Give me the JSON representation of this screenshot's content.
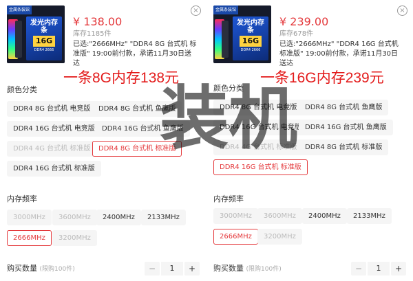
{
  "panels": [
    {
      "thumb": {
        "tag": "金属条装馆",
        "title": "发光内存条",
        "capacity": "16G",
        "subtitle": "DDR4 2666"
      },
      "price": "¥ 138.00",
      "stock": "库存1185件",
      "selected": "已选:\"2666MHz\" \"DDR4 8G 台式机 标准版\" 19:00前付款，承诺11月30日送达",
      "overlay": "一条8G内存138元",
      "color_section_title": "颜色分类",
      "colors": [
        {
          "label": "DDR4 8G 台式机 电竞版",
          "state": "normal"
        },
        {
          "label": "DDR4 8G 台式机 鱼鹰版",
          "state": "normal"
        },
        {
          "label": "DDR4 16G 台式机 电竞版",
          "state": "normal"
        },
        {
          "label": "DDR4 16G 台式机 鱼鹰版",
          "state": "normal"
        },
        {
          "label": "DDR4 4G 台式机 标准版",
          "state": "disabled"
        },
        {
          "label": "DDR4 8G 台式机 标准版",
          "state": "active"
        },
        {
          "label": "DDR4 16G 台式机 标准版",
          "state": "normal"
        }
      ],
      "freq_section_title": "内存频率",
      "freqs": [
        {
          "label": "3000MHz",
          "state": "disabled"
        },
        {
          "label": "3600MHz",
          "state": "disabled"
        },
        {
          "label": "2400MHz",
          "state": "normal"
        },
        {
          "label": "2133MHz",
          "state": "normal"
        },
        {
          "label": "2666MHz",
          "state": "active"
        },
        {
          "label": "3200MHz",
          "state": "disabled"
        }
      ],
      "qty_title": "购买数量",
      "qty_limit": "(限购100件)",
      "qty": "1",
      "minus": "−",
      "plus": "+"
    },
    {
      "thumb": {
        "tag": "金属条装馆",
        "title": "发光内存条",
        "capacity": "16G",
        "subtitle": "DDR4 2666"
      },
      "price": "¥ 239.00",
      "stock": "库存678件",
      "selected": "已选:\"2666MHz\" \"DDR4 16G 台式机 标准版\" 19:00前付款，承诺11月30日送达",
      "overlay": "一条16G内存239元",
      "color_section_title": "颜色分类",
      "colors": [
        {
          "label": "DDR4 8G 台式机 电竞版",
          "state": "normal"
        },
        {
          "label": "DDR4 8G 台式机 鱼鹰版",
          "state": "normal"
        },
        {
          "label": "DDR4 16G 台式机 电竞版",
          "state": "normal"
        },
        {
          "label": "DDR4 16G 台式机 鱼鹰版",
          "state": "normal"
        },
        {
          "label": "DDR4 4G 台式机 标准版",
          "state": "disabled"
        },
        {
          "label": "DDR4 8G 台式机 标准版",
          "state": "normal"
        },
        {
          "label": "DDR4 16G 台式机 标准版",
          "state": "active"
        }
      ],
      "freq_section_title": "内存频率",
      "freqs": [
        {
          "label": "3000MHz",
          "state": "disabled"
        },
        {
          "label": "3600MHz",
          "state": "disabled"
        },
        {
          "label": "2400MHz",
          "state": "normal"
        },
        {
          "label": "2133MHz",
          "state": "normal"
        },
        {
          "label": "2666MHz",
          "state": "active"
        },
        {
          "label": "3200MHz",
          "state": "disabled"
        }
      ],
      "qty_title": "购买数量",
      "qty_limit": "(限购100件)",
      "qty": "1",
      "minus": "−",
      "plus": "+"
    }
  ],
  "close_glyph": "×",
  "watermark": "装机",
  "colors": {
    "accent": "#e4393c",
    "overlay": "#e31a1a",
    "chip_bg": "#f5f5f5"
  }
}
